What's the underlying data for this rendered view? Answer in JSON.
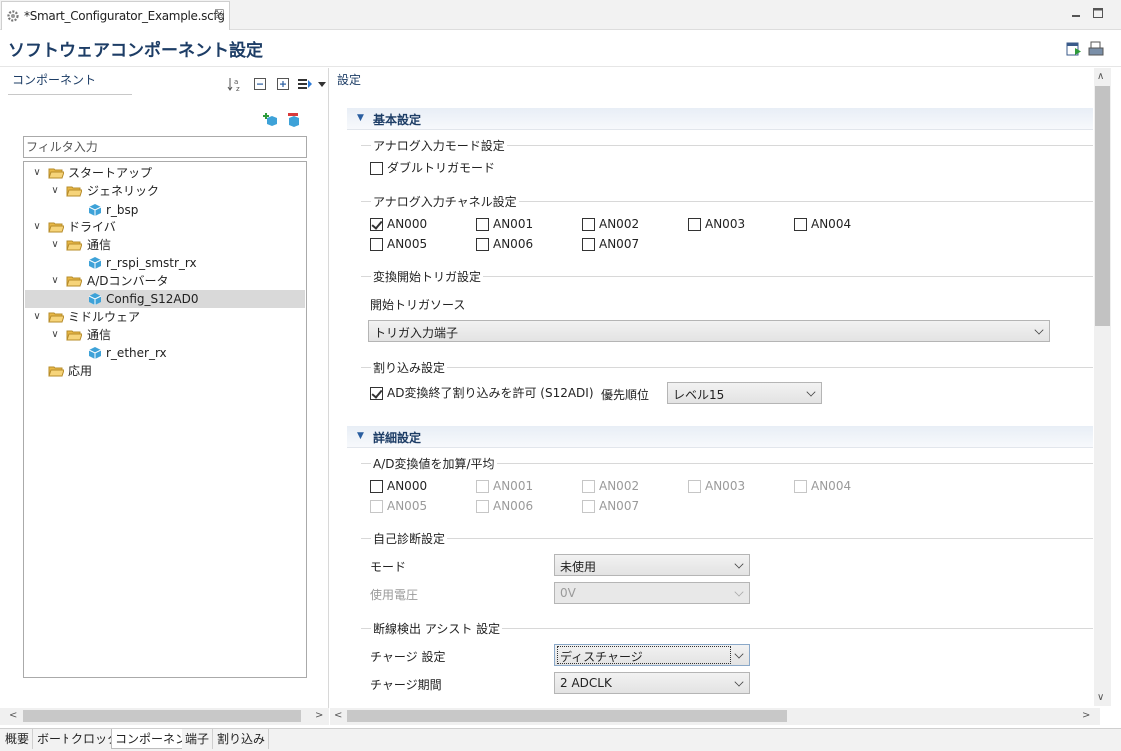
{
  "editor_tab": {
    "title": "*Smart_Configurator_Example.scfg",
    "close": "☒"
  },
  "header": {
    "title": "ソフトウェアコンポーネント設定"
  },
  "left_panel": {
    "title": "コンポーネント",
    "filter_placeholder": "フィルタ入力",
    "tree": [
      {
        "label": "スタートアップ",
        "level": 0,
        "kind": "folder",
        "expanded": true
      },
      {
        "label": "ジェネリック",
        "level": 1,
        "kind": "folder",
        "expanded": true
      },
      {
        "label": "r_bsp",
        "level": 2,
        "kind": "component"
      },
      {
        "label": "ドライバ",
        "level": 0,
        "kind": "folder",
        "expanded": true
      },
      {
        "label": "通信",
        "level": 1,
        "kind": "folder",
        "expanded": true
      },
      {
        "label": "r_rspi_smstr_rx",
        "level": 2,
        "kind": "component"
      },
      {
        "label": "A/Dコンバータ",
        "level": 1,
        "kind": "folder",
        "expanded": true
      },
      {
        "label": "Config_S12AD0",
        "level": 2,
        "kind": "component",
        "selected": true
      },
      {
        "label": "ミドルウェア",
        "level": 0,
        "kind": "folder",
        "expanded": true
      },
      {
        "label": "通信",
        "level": 1,
        "kind": "folder",
        "expanded": true
      },
      {
        "label": "r_ether_rx",
        "level": 2,
        "kind": "component"
      },
      {
        "label": "応用",
        "level": 0,
        "kind": "folder",
        "expanded": false
      }
    ]
  },
  "right_panel": {
    "title": "設定",
    "basic": {
      "title": "基本設定",
      "analog_mode": {
        "title": "アナログ入力モード設定",
        "double_trigger": {
          "label": "ダブルトリガモード",
          "checked": false
        }
      },
      "channels": {
        "title": "アナログ入力チャネル設定",
        "items": [
          {
            "label": "AN000",
            "checked": true
          },
          {
            "label": "AN001",
            "checked": false
          },
          {
            "label": "AN002",
            "checked": false
          },
          {
            "label": "AN003",
            "checked": false
          },
          {
            "label": "AN004",
            "checked": false
          },
          {
            "label": "AN005",
            "checked": false
          },
          {
            "label": "AN006",
            "checked": false
          },
          {
            "label": "AN007",
            "checked": false
          }
        ]
      },
      "trigger": {
        "title": "変換開始トリガ設定",
        "source_label": "開始トリガソース",
        "source_value": "トリガ入力端子"
      },
      "interrupt": {
        "title": "割り込み設定",
        "enable_label": "AD変換終了割り込みを許可 (S12ADI)",
        "enable_checked": true,
        "priority_label": "優先順位",
        "priority_value": "レベル15"
      }
    },
    "detail": {
      "title": "詳細設定",
      "addavg": {
        "title": "A/D変換値を加算/平均",
        "items": [
          {
            "label": "AN000",
            "checked": false,
            "disabled": false
          },
          {
            "label": "AN001",
            "checked": false,
            "disabled": true
          },
          {
            "label": "AN002",
            "checked": false,
            "disabled": true
          },
          {
            "label": "AN003",
            "checked": false,
            "disabled": true
          },
          {
            "label": "AN004",
            "checked": false,
            "disabled": true
          },
          {
            "label": "AN005",
            "checked": false,
            "disabled": true
          },
          {
            "label": "AN006",
            "checked": false,
            "disabled": true
          },
          {
            "label": "AN007",
            "checked": false,
            "disabled": true
          }
        ]
      },
      "selfdiag": {
        "title": "自己診断設定",
        "mode_label": "モード",
        "mode_value": "未使用",
        "voltage_label": "使用電圧",
        "voltage_value": "0V"
      },
      "disconnect": {
        "title": "断線検出 アシスト 設定",
        "charge_label": "チャージ 設定",
        "charge_value": "ディスチャージ",
        "period_label": "チャージ期間",
        "period_value": "2 ADCLK"
      }
    }
  },
  "bottom_tabs": [
    {
      "label": "概要"
    },
    {
      "label": "ボード"
    },
    {
      "label": "クロック"
    },
    {
      "label": "コンポーネント",
      "active": true
    },
    {
      "label": "端子"
    },
    {
      "label": "割り込み"
    }
  ],
  "colors": {
    "title": "#1d3d66",
    "section_bg": "#e8eef6",
    "selection": "#d9d9d9"
  }
}
